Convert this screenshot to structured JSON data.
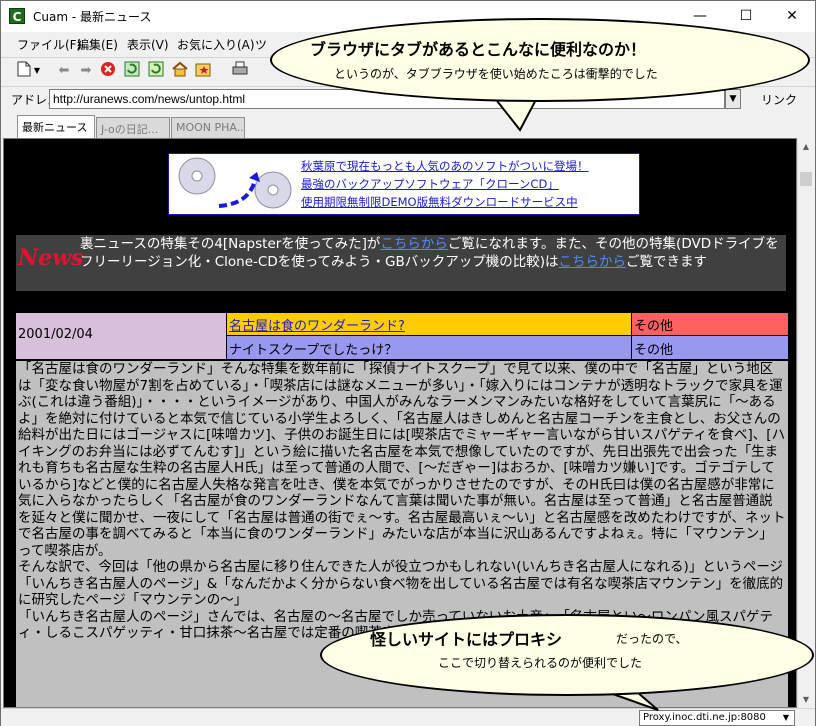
{
  "window": {
    "app_icon": "C",
    "title": "Cuam - 最新ニュース",
    "controls": {
      "minimize": "—",
      "maximize": "☐",
      "close": "✕"
    }
  },
  "menubar": {
    "items": [
      "ファイル(F)",
      "編集(E)",
      "表示(V)",
      "お気に入り(A)",
      "ツ"
    ]
  },
  "toolbar": {
    "icons": [
      "new-page-icon",
      "dropdown-icon",
      "back-icon",
      "forward-icon",
      "stop-icon",
      "refresh-icon",
      "refresh-all-icon",
      "home-icon",
      "favorites-icon",
      "print-icon"
    ]
  },
  "addressbar": {
    "label": "アドレス",
    "url": "http://uranews.com/news/untop.html",
    "link_label": "リンク"
  },
  "tabs": [
    {
      "label": "最新ニュース",
      "active": true
    },
    {
      "label": "J-oの日記...",
      "active": false
    },
    {
      "label": "MOON PHA...",
      "active": false
    }
  ],
  "banner": {
    "lines": [
      "秋葉原で現在もっとも人気のあのソフトがついに登場！",
      "最強のバックアップソフトウェア「クローンCD」",
      "使用期限無制限DEMO版無料ダウンロードサービス中"
    ]
  },
  "news": {
    "logo": "News",
    "text_1": "裏ニュースの特集その4[Napsterを使ってみた]が",
    "link_1": "こちらから",
    "text_2": "ご覧になれます。また、その他の特集(DVDドライブをフリーリージョン化・Clone-CDを使ってみよう・GBバックアップ機の比較)は",
    "link_2": "こちらから",
    "text_3": "ご覧できます"
  },
  "article": {
    "date": "2001/02/04",
    "title": "名古屋は食のワンダーランド?",
    "category_1": "その他",
    "subtitle": "ナイトスクープでしたっけ？",
    "category_2": "その他",
    "body": "「名古屋は食のワンダーランド」そんな特集を数年前に「探偵ナイトスクープ」で見て以来、僕の中で「名古屋」という地区は「変な食い物屋が7割を占めている」・「喫茶店には謎なメニューが多い」・「嫁入りにはコンテナが透明なトラックで家具を運ぶ(これは違う番組)」・・・・というイメージがあり、中国人がみんなラーメンマンみたいな格好をしていて言葉尻に「〜あるよ」を絶対に付けていると本気で信じている小学生よろしく、「名古屋人はきしめんと名古屋コーチンを主食とし、お父さんの給料が出た日にはゴージャスに[味噌カツ]、子供のお誕生日には[喫茶店でミャーギャー言いながら甘いスパゲティを食べ]、[ハイキングのお弁当には必ずてんむす]」という絵に描いた名古屋を本気で想像していたのですが、先日出張先で出会った「生まれも育ちも名古屋な生粋の名古屋人H氏」は至って普通の人間で、[〜だぎゃー]はおろか、[味噌カツ嫌い]です。ゴテゴテしているから]などと僕的に名古屋人失格な発言を吐き、僕を本気でがっかりさせたのですが、そのH氏曰は僕の名古屋感が非常に気に入らなかったらしく「名古屋が食のワンダーランドなんて言葉は聞いた事が無い。名古屋は至って普通」と名古屋普通説を延々と僕に聞かせ、一夜にして「名古屋は普通の街でぇ〜す。名古屋最高いぇ〜い」と名古屋感を改めたわけですが、ネットで名古屋の事を調べてみると「本当に食のワンダーランド」みたいな店が本当に沢山あるんですよねぇ。特に「マウンテン」って喫茶店が。\nそんな訳で、今回は「他の県から名古屋に移り住んできた人が役立つかもしれない(いんちき名古屋人になれる)」というページ「いんちき名古屋人のページ」&「なんだかよく分からない食べ物を出している名古屋では有名な喫茶店マウンテン」を徹底的に研究したページ「マウンテンの〜」\n「いんちき名古屋人のページ」さんでは、名古屋の〜名古屋でしか売っていないお土産」・「名古屋とい〜ロンパン風スパゲティ・しるこスパゲッティ・甘口抹茶〜名古屋では定番の喫茶店「マウンテン」を徹底的に研究されています。"
  },
  "callouts": {
    "top_title": "ブラウザにタブがあるとこんなに便利なのか！",
    "top_sub": "というのが、タブブラウザを使い始めたころは衝撃的でした",
    "bottom_title": "怪しいサイトにはプロキシ",
    "bottom_suffix": "だったので、",
    "bottom_sub": "ここで切り替えられるのが便利でした"
  },
  "statusbar": {
    "proxy": "Proxy.inoc.dti.ne.jp:8080"
  }
}
